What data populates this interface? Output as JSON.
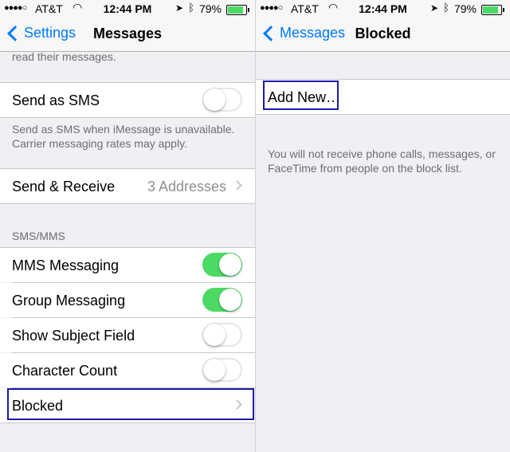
{
  "status": {
    "signal": "●●●●○",
    "carrier": "AT&T",
    "time": "12:44 PM",
    "battery": "79%",
    "battery_level": 0.79
  },
  "left": {
    "nav": {
      "back": "Settings",
      "title": "Messages"
    },
    "top_note": "read their messages.",
    "send_as_sms": {
      "label": "Send as SMS",
      "on": false
    },
    "sms_note": "Send as SMS when iMessage is unavailable. Carrier messaging rates may apply.",
    "send_receive": {
      "label": "Send & Receive",
      "detail": "3 Addresses"
    },
    "sms_mms_header": "SMS/MMS",
    "rows": [
      {
        "label": "MMS Messaging",
        "on": true
      },
      {
        "label": "Group Messaging",
        "on": true
      },
      {
        "label": "Show Subject Field",
        "on": false
      },
      {
        "label": "Character Count",
        "on": false
      }
    ],
    "blocked": {
      "label": "Blocked"
    }
  },
  "right": {
    "nav": {
      "back": "Messages",
      "title": "Blocked"
    },
    "add_new": "Add New…",
    "note": "You will not receive phone calls, messages, or FaceTime from people on the block list."
  },
  "colors": {
    "accent": "#007aff",
    "toggle_on": "#4cd964",
    "highlight": "#1a1aa8"
  }
}
